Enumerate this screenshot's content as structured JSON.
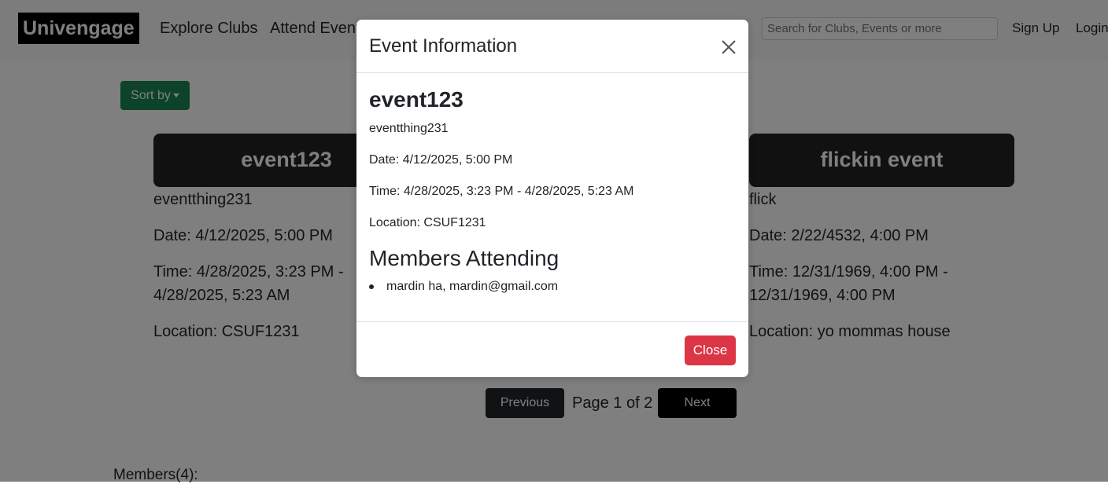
{
  "navbar": {
    "brand": "Univengage",
    "links": [
      "Explore Clubs",
      "Attend Events"
    ],
    "search_placeholder": "Search for Clubs, Events or more",
    "signup": "Sign Up",
    "login": "Login"
  },
  "main": {
    "sort_label": "Sort by",
    "cards": [
      {
        "title": "event123",
        "desc": "eventthing231",
        "date": "Date: 4/12/2025, 5:00 PM",
        "time_line1": "Time: 4/28/2025, 3:23 PM -",
        "time_line2": "4/28/2025, 5:23 AM",
        "location": "Location: CSUF1231"
      },
      {
        "title": "flickin event",
        "desc": "flick",
        "date": "Date: 2/22/4532, 4:00 PM",
        "time_line1": "Time: 12/31/1969, 4:00 PM -",
        "time_line2": "12/31/1969, 4:00 PM",
        "location": "Location: yo mommas house"
      }
    ],
    "pager": {
      "previous": "Previous",
      "info": "Page 1 of 2",
      "next": "Next"
    },
    "members_count": "Members(4):"
  },
  "modal": {
    "title": "Event Information",
    "event_name": "event123",
    "description": "eventthing231",
    "date": "Date: 4/12/2025, 5:00 PM",
    "time": "Time: 4/28/2025, 3:23 PM - 4/28/2025, 5:23 AM",
    "location": "Location: CSUF1231",
    "members_heading": "Members Attending",
    "members": [
      "mardin ha, mardin@gmail.com"
    ],
    "close_label": "Close"
  },
  "colors": {
    "sort_button": "#198754",
    "close_button": "#dc3545",
    "card_header": "#222222",
    "next_button": "#000000"
  }
}
